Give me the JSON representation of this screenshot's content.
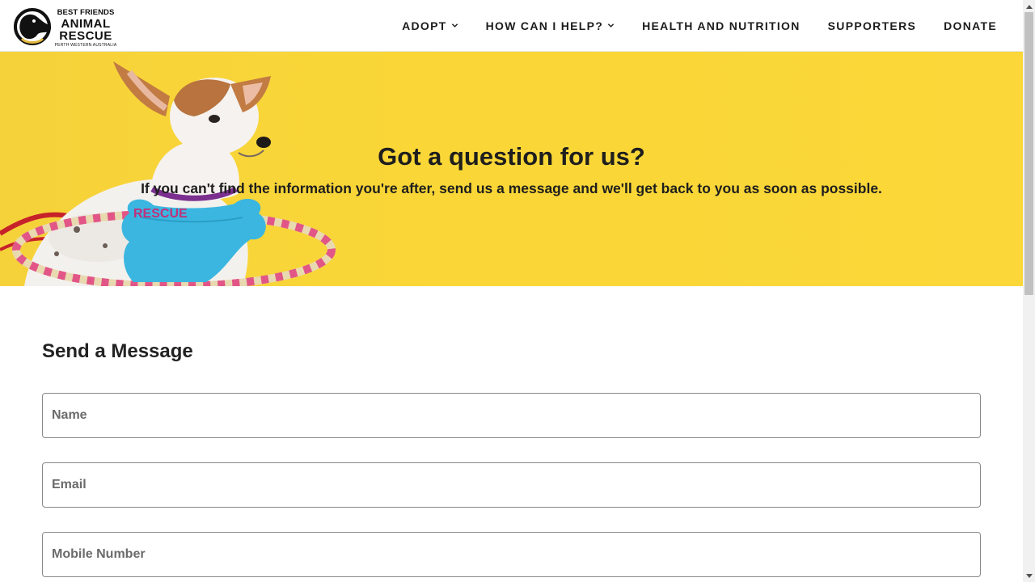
{
  "header": {
    "logo": {
      "line1": "BEST FRIENDS",
      "line2": "ANIMAL",
      "line3": "RESCUE",
      "line4": "PERTH WESTERN AUSTRALIA",
      "icon": "dog-head-logo"
    },
    "nav": [
      {
        "label": "ADOPT",
        "has_dropdown": true,
        "icon": "chevron-down-icon"
      },
      {
        "label": "HOW CAN I HELP?",
        "has_dropdown": true,
        "icon": "chevron-down-icon"
      },
      {
        "label": "HEALTH AND NUTRITION",
        "has_dropdown": false
      },
      {
        "label": "SUPPORTERS",
        "has_dropdown": false
      },
      {
        "label": "DONATE",
        "has_dropdown": false
      }
    ]
  },
  "hero": {
    "title": "Got a question for us?",
    "subtitle": "If you can't find the information you're after, send us a message and we'll get back to you as soon as possible.",
    "toy_text": "RESCUE",
    "background_color": "#fad736"
  },
  "form": {
    "heading": "Send a Message",
    "fields": {
      "name": {
        "placeholder": "Name",
        "value": ""
      },
      "email": {
        "placeholder": "Email",
        "value": ""
      },
      "mobile": {
        "placeholder": "Mobile Number",
        "value": ""
      }
    }
  },
  "colors": {
    "accent_yellow": "#fad736",
    "text_dark": "#1e1e1e",
    "field_border": "#8a8a8a"
  }
}
